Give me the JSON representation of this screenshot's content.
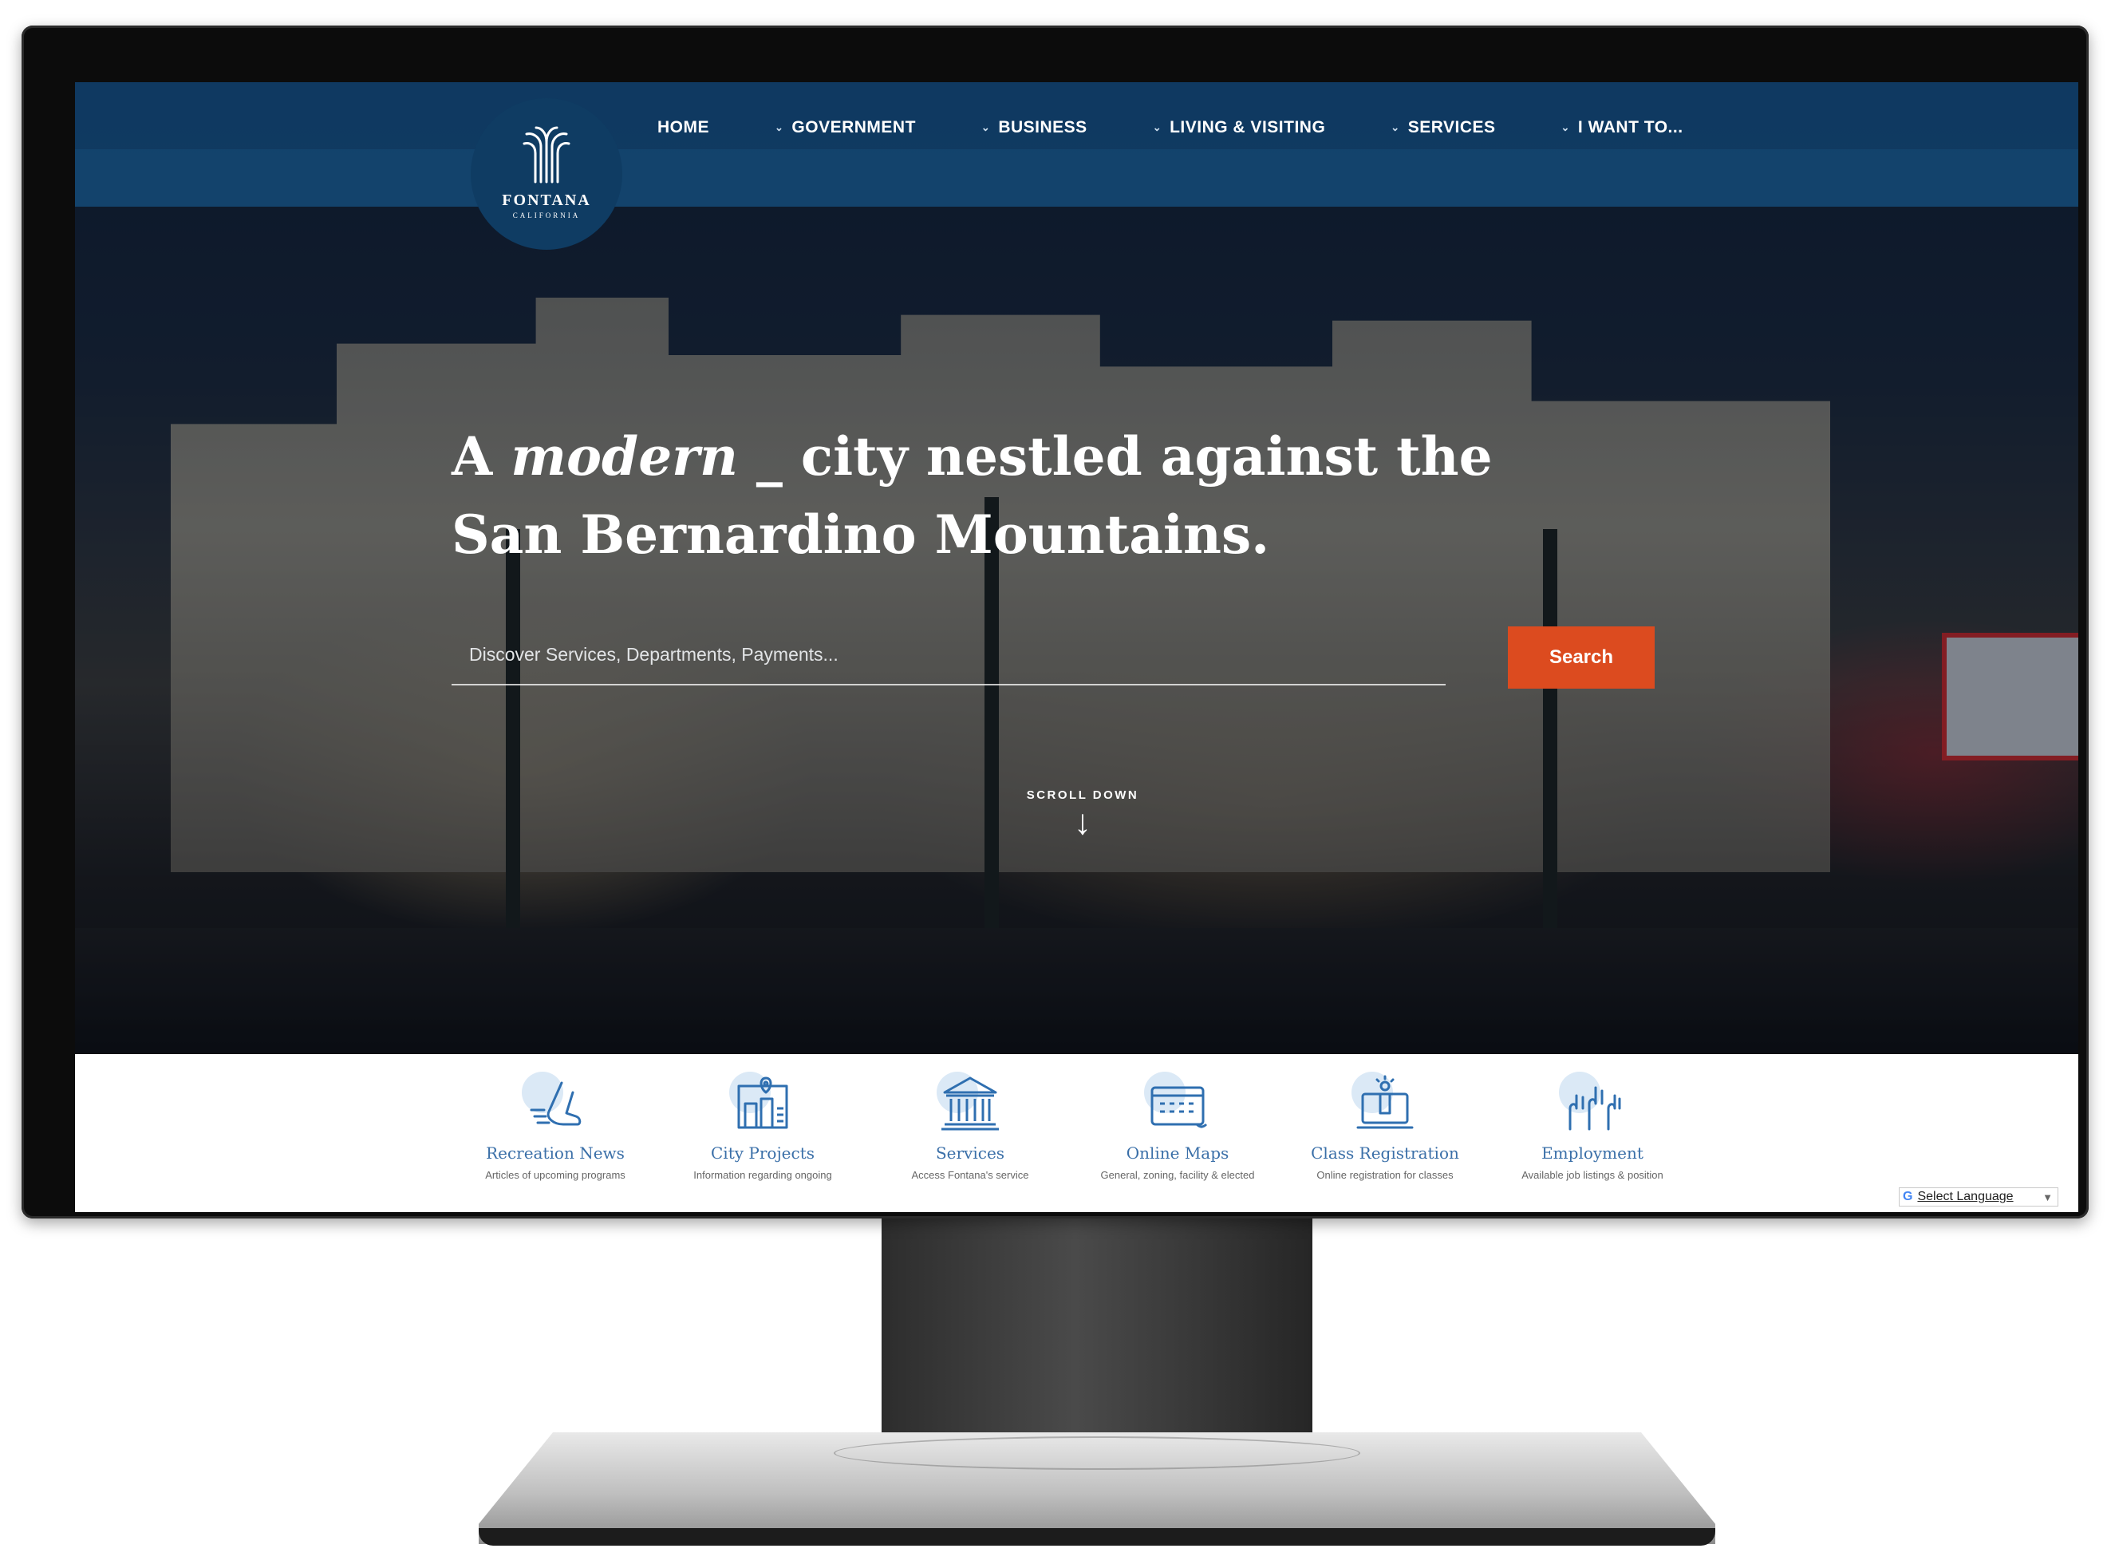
{
  "site": {
    "logo": {
      "name": "FONTANA",
      "sub": "CALIFORNIA"
    }
  },
  "nav": {
    "items": [
      {
        "label": "HOME",
        "has_dropdown": false
      },
      {
        "label": "GOVERNMENT",
        "has_dropdown": true
      },
      {
        "label": "BUSINESS",
        "has_dropdown": true
      },
      {
        "label": "LIVING & VISITING",
        "has_dropdown": true
      },
      {
        "label": "SERVICES",
        "has_dropdown": true
      },
      {
        "label": "I WANT TO...",
        "has_dropdown": true
      }
    ]
  },
  "hero": {
    "headline_pre": "A ",
    "headline_em": "modern",
    "headline_post": " _ city nestled against the San Bernardino Mountains.",
    "search_placeholder": "Discover Services, Departments, Payments...",
    "search_button": "Search",
    "scroll_label": "SCROLL DOWN",
    "scroll_arrow": "↓"
  },
  "quicklinks": [
    {
      "title": "Recreation News",
      "desc": "Articles of upcoming programs",
      "icon": "running-shoe-icon"
    },
    {
      "title": "City Projects",
      "desc": "Information regarding ongoing",
      "icon": "city-map-icon"
    },
    {
      "title": "Services",
      "desc": "Access Fontana's service",
      "icon": "government-building-icon"
    },
    {
      "title": "Online Maps",
      "desc": "General, zoning, facility & elected",
      "icon": "map-calendar-icon"
    },
    {
      "title": "Class Registration",
      "desc": "Online registration for classes",
      "icon": "laptop-registration-icon"
    },
    {
      "title": "Employment",
      "desc": "Available job listings & position",
      "icon": "raised-hands-icon"
    }
  ],
  "translate": {
    "g": "G",
    "label": "Select Language",
    "arrow": "▼"
  },
  "colors": {
    "brand_navy": "#0f3c63",
    "nav_band": "#103d66",
    "accent_orange": "#dc4b1f",
    "link_blue": "#3a6fa8"
  }
}
